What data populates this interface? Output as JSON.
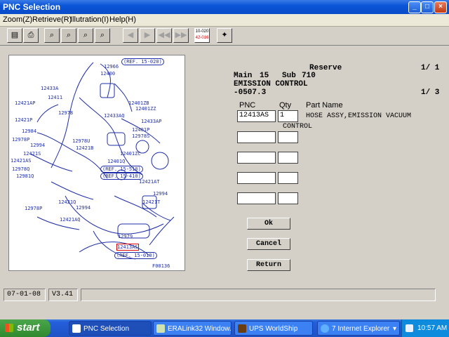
{
  "window": {
    "title": "PNC Selection",
    "minimize": "_",
    "maximize": "□",
    "close": "×"
  },
  "menu": [
    "Zoom(Z)",
    "Retrieve(R)",
    "Illutration(I)",
    "Help(H)"
  ],
  "toolbar": {
    "counter_top": "10-020",
    "counter_bottom": "42-016"
  },
  "diagram": {
    "labels": [
      "12966",
      "12400",
      "(REF. 15-020)",
      "12433A",
      "12411",
      "12421AP",
      "12978",
      "12401ZB",
      "12401ZZ",
      "12433AQ",
      "12433AP",
      "12421P",
      "12984",
      "12978P",
      "12978U",
      "12994",
      "12401P",
      "12978S",
      "12421S",
      "12421AS",
      "12421B",
      "12978Q",
      "12401ZC",
      "12401Q",
      "12981Q",
      "(REF. 15-510)",
      "(REF. 15-410)",
      "12421AT",
      "12994",
      "12421T",
      "12421Q",
      "12978P",
      "12994",
      "12421AQ",
      "12979",
      "12413AS",
      "(REF. 15-010)",
      "F00136"
    ]
  },
  "reserve": {
    "label": "Reserve",
    "page_top": "1/ 1",
    "page_bottom": "1/ 3"
  },
  "info": {
    "main_label": "Main",
    "main_value": "15",
    "sub_label": "Sub",
    "sub_value": "710",
    "group_name": "EMISSION CONTROL",
    "code": "-0507.3"
  },
  "columns": {
    "pnc": "PNC",
    "qty": "Qty",
    "part_name": "Part Name"
  },
  "rows": [
    {
      "pnc": "12413AS",
      "qty": "1",
      "part_name_line1": "HOSE ASSY,EMISSION VACUUM",
      "part_name_line2": "CONTROL"
    },
    {
      "pnc": "",
      "qty": ""
    },
    {
      "pnc": "",
      "qty": ""
    },
    {
      "pnc": "",
      "qty": ""
    },
    {
      "pnc": "",
      "qty": ""
    }
  ],
  "buttons": {
    "ok": "Ok",
    "cancel": "Cancel",
    "return": "Return"
  },
  "status": {
    "date": "07-01-08",
    "version": "V3.41",
    "message": ""
  },
  "taskbar": {
    "start": "start",
    "tasks": [
      "PNC Selection",
      "ERALink32 Window...",
      "UPS WorldShip",
      "7 Internet Explorer"
    ],
    "clock": "10:57 AM"
  }
}
